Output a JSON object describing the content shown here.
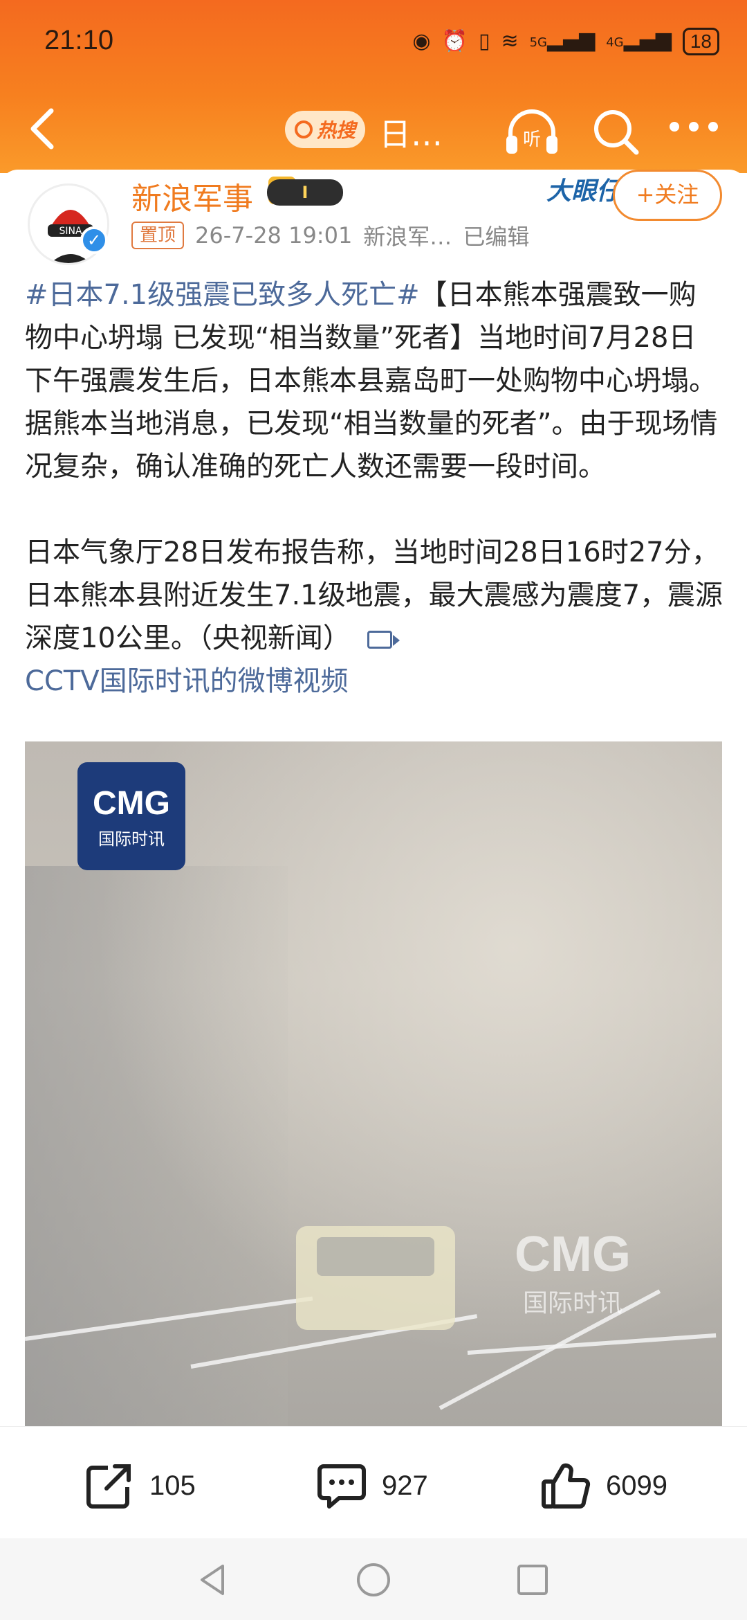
{
  "status_bar": {
    "time": "21:10",
    "battery": "18",
    "network_labels": [
      "5G",
      "4G"
    ]
  },
  "nav": {
    "hot_label": "热搜",
    "title": "日…"
  },
  "post": {
    "author": "新浪军事",
    "rank_badge": "I",
    "big_eye_badge": "大眼仔",
    "follow_label": "+关注",
    "pinned_label": "置顶",
    "timestamp": "26-7-28 19:01",
    "source": "新浪军…",
    "edited_label": "已编辑",
    "hashtag": "#日本7.1级强震已致多人死亡#",
    "paragraph1": "【日本熊本强震致一购物中心坍塌 已发现“相当数量”死者】当地时间7月28日下午强震发生后，日本熊本县嘉岛町一处购物中心坍塌。据熊本当地消息，已发现“相当数量的死者”。由于现场情况复杂，确认准确的死亡人数还需要一段时间。",
    "paragraph2": "日本气象厅28日发布报告称，当地时间28日16时27分，日本熊本县附近发生7.1级地震，最大震感为震度7，震源深度10公里。（央视新闻）",
    "video_link": "CCTV国际时讯的微博视频",
    "video_logo_big": "CMG",
    "video_logo_small": "国际时讯"
  },
  "actions": {
    "shares": "105",
    "comments": "927",
    "likes": "6099"
  }
}
